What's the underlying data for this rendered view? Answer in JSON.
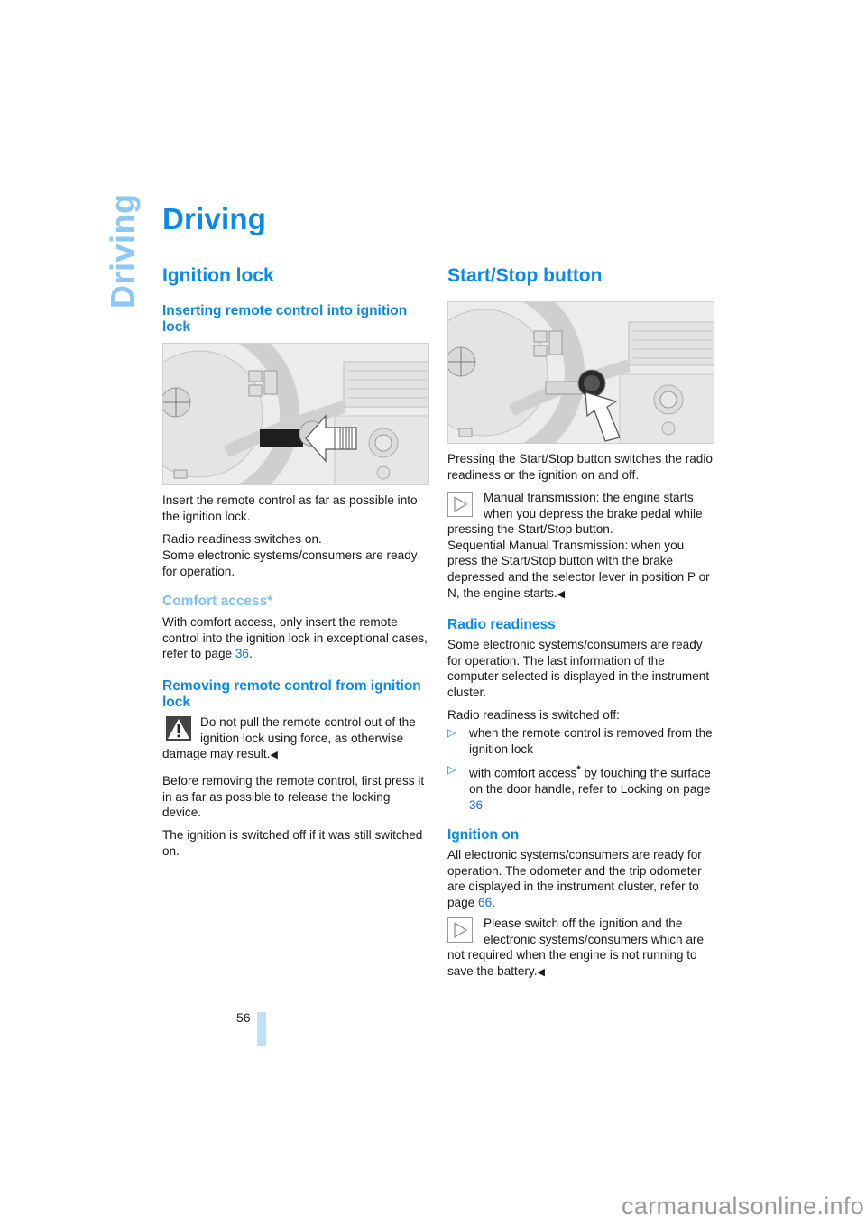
{
  "side_tab": "Driving",
  "page_title": "Driving",
  "left": {
    "h2": "Ignition lock",
    "h3_inserting": "Inserting remote control into ignition lock",
    "figure_insert": "steering-wheel-ignition-illustration",
    "p_insert": "Insert the remote control as far as possible into the ignition lock.",
    "p_radio_1": "Radio readiness switches on.",
    "p_radio_2": "Some electronic systems/consumers are ready for operation.",
    "h3_comfort": "Comfort access*",
    "p_comfort_pre": "With comfort access, only insert the remote control into the ignition lock in exceptional cases, refer to page ",
    "p_comfort_link": "36",
    "p_comfort_post": ".",
    "h3_removing": "Removing remote control from ignition lock",
    "warning_text": "Do not pull the remote control out of the ignition lock using force, as otherwise damage may result.",
    "p_remove": "Before removing the remote control, first press it in as far as possible to release the locking device.",
    "p_switched_off": "The ignition is switched off if it was still switched on."
  },
  "right": {
    "h2": "Start/Stop button",
    "figure_start": "start-stop-button-illustration",
    "p_pressing": "Pressing the Start/Stop button switches the radio readiness or the ignition on and off.",
    "note1_a": "Manual transmission: the engine starts when you depress the brake pedal while pressing the Start/Stop button.",
    "note1_b": "Sequential Manual Transmission: when you press the Start/Stop button with the brake depressed and the selector lever in position P or N, the engine starts.",
    "h3_radio": "Radio readiness",
    "p_radio": "Some electronic systems/consumers are ready for operation. The last information of the computer selected is displayed in the instrument cluster.",
    "p_radio_off": "Radio readiness is switched off:",
    "bullets": [
      {
        "text": "when the remote control is removed from the ignition lock"
      },
      {
        "pre": "with comfort access",
        "star": "*",
        "post": " by touching the surface on the door handle, refer to Locking on page ",
        "link": "36"
      }
    ],
    "h3_ignition": "Ignition on",
    "p_ignition_pre": "All electronic systems/consumers are ready for operation. The odometer and the trip odometer are displayed in the instrument cluster, refer to page ",
    "p_ignition_link": "66",
    "p_ignition_post": ".",
    "note2": "Please switch off the ignition and the electronic systems/consumers which are not required when the engine is not running to save the battery."
  },
  "end_mark": "◀",
  "page_number": "56",
  "watermark": "carmanualsonline.info",
  "colors": {
    "heading": "#0a8ae6",
    "heading_light": "#7cc2f7",
    "link": "#1a6de0",
    "side_tab": "#8cc8f5",
    "page_bar": "#bfe0fb"
  }
}
